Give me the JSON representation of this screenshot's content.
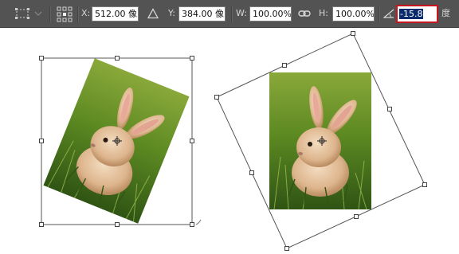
{
  "options_bar": {
    "x_label": "X:",
    "x_value": "512.00 像",
    "y_label": "Y:",
    "y_value": "384.00 像",
    "w_label": "W:",
    "w_value": "100.00%",
    "h_label": "H:",
    "h_value": "100.00%",
    "angle_value": "-15.8",
    "angle_unit": "度",
    "icons": {
      "tool_preset": "transform-tool-icon",
      "reference_point": "reference-point-grid-icon",
      "relative": "delta-triangle-icon",
      "link": "chain-link-icon",
      "angle": "angle-icon"
    },
    "colors": {
      "highlight": "#c8141e",
      "selection": "#0a2c6e",
      "bar": "#535353"
    }
  },
  "canvas": {
    "images": [
      {
        "name": "rotated-bunny-photo-left",
        "angle_degrees": -15.8
      },
      {
        "name": "bunny-photo-right",
        "angle_degrees": 0
      }
    ]
  }
}
